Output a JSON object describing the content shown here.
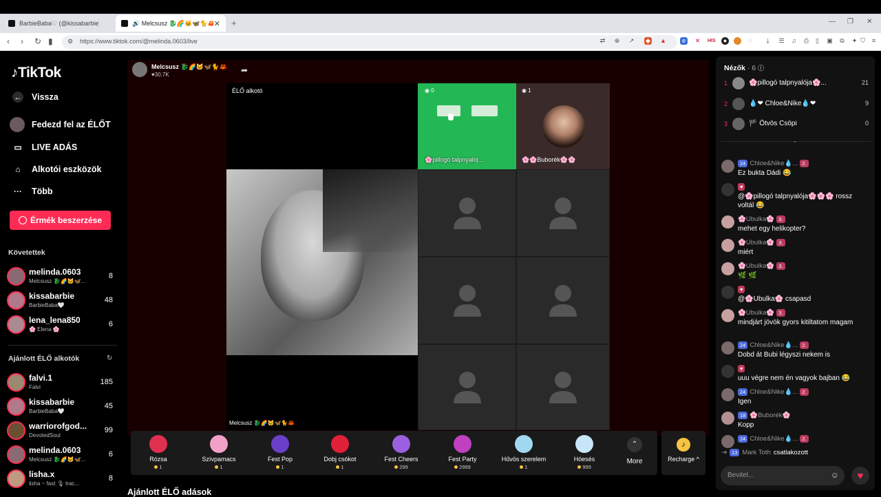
{
  "browser": {
    "tabs": [
      {
        "title": "BarbieBaba♡ (@kissabarbie) Élő",
        "active": false
      },
      {
        "title": "🔊 Melcsusz 🐉🌈🐱🦋🐈🦀 (@",
        "active": true
      }
    ],
    "url": "https://www.tiktok.com/@melinda.0603/live"
  },
  "sidebar": {
    "logo": "TikTok",
    "nav": [
      {
        "label": "Vissza",
        "icon": "arrow-left-icon"
      },
      {
        "label": "Fedezd fel az ÉLŐT",
        "icon": "avatar-icon"
      },
      {
        "label": "LIVE ADÁS",
        "icon": "video-camera-icon"
      },
      {
        "label": "Alkotói eszközök",
        "icon": "lightbulb-icon"
      },
      {
        "label": "Több",
        "icon": "more-dots-icon"
      }
    ],
    "coins_button": "Érmék beszerzése",
    "following_title": "Követettek",
    "following": [
      {
        "name": "melinda.0603",
        "sub": "Melcsusz 🐉🌈🐱🦋...",
        "count": "8"
      },
      {
        "name": "kissabarbie",
        "sub": "BarbieBaba🤍",
        "count": "48"
      },
      {
        "name": "lena_lena850",
        "sub": "🌸 Elena 🌸",
        "count": "6"
      }
    ],
    "recommended_title": "Ajánlott ÉLŐ alkotók",
    "recommended": [
      {
        "name": "falvi.1",
        "sub": "Falvi",
        "count": "185"
      },
      {
        "name": "kissabarbie",
        "sub": "BarbieBaba🤍",
        "count": "45"
      },
      {
        "name": "warriorofgod...",
        "sub": "DevotedSoul",
        "count": "99"
      },
      {
        "name": "melinda.0603",
        "sub": "Melcsusz 🐉🌈🐱🦋...",
        "count": "6"
      },
      {
        "name": "lisha.x",
        "sub": "lisha ~ fast 🎙 trac...",
        "count": "8"
      }
    ]
  },
  "live": {
    "host_name": "Melcsusz 🐉🌈🐱🦋🐈🦀",
    "host_likes": "♥30.7K",
    "host_label": "ÉLŐ alkotó",
    "guest1_count": "0",
    "guest1_name": "🌸pillogó talpnyalój...",
    "guest2_count": "1",
    "guest2_name": "🌸🌸Buborék🌸🌸",
    "bottom_host_label": "Melcsusz 🐉🌈🐱🦋🐈🦀"
  },
  "gifts": [
    {
      "name": "Rózsa",
      "price": "1",
      "color": "#e03050"
    },
    {
      "name": "Szívpamacs",
      "price": "1",
      "color": "#f2a0c8"
    },
    {
      "name": "Fest Pop",
      "price": "1",
      "color": "#6a40c8"
    },
    {
      "name": "Dobj csókot",
      "price": "1",
      "color": "#e0203a"
    },
    {
      "name": "Fest Cheers",
      "price": "299",
      "color": "#9a60e0"
    },
    {
      "name": "Fest Party",
      "price": "2999",
      "color": "#c040c0"
    },
    {
      "name": "Hűvös szerelem",
      "price": "1",
      "color": "#a0d8f0"
    },
    {
      "name": "Hóesés",
      "price": "999",
      "color": "#c8e4f8"
    }
  ],
  "more_label": "More",
  "recharge_label": "Recharge ^",
  "recommended_lives_title": "Ajánlott ÉLŐ adások",
  "chat": {
    "viewers_label": "Nézők",
    "viewers_count": "· 6",
    "top_viewers": [
      {
        "rank": "1",
        "name": "🌸pillogó talpnyalója🌸...",
        "score": "21"
      },
      {
        "rank": "2",
        "name": "💧❤ Chloe&Nike💧❤",
        "score": "9"
      },
      {
        "rank": "3",
        "name": "🏴 Ötvös Csöpi",
        "score": "0"
      }
    ],
    "messages": [
      {
        "badges": [
          "24",
          "2."
        ],
        "user": "Chloe&Nike💧...",
        "text": "Ez bukta Dádi 😂"
      },
      {
        "badges": [],
        "user": "",
        "text": "@🌸pillogó talpnyalója🌸🌸🌸 rossz voltál 😂"
      },
      {
        "badges": [
          "3."
        ],
        "user": "🌸Ubulka🌸",
        "text": "mehet egy helikopter?"
      },
      {
        "badges": [
          "3."
        ],
        "user": "🌸Ubulka🌸",
        "text": "miért"
      },
      {
        "badges": [
          "3."
        ],
        "user": "🌸Ubulka🌸",
        "text": "🌿 🌿"
      },
      {
        "badges": [],
        "user": "",
        "text": "@🌸Ubulka🌸 csapasd"
      },
      {
        "badges": [
          "3."
        ],
        "user": "🌸Ubulka🌸",
        "text": "mindjárt jövök gyors kitiltatom magam"
      },
      {
        "badges": [
          "24",
          "2."
        ],
        "user": "Chloe&Nike💧...",
        "text": "Dobd át Bubi légyszi nekem is"
      },
      {
        "badges": [],
        "user": "",
        "text": "uuu végre nem én vagyok bajban 😂"
      },
      {
        "badges": [
          "24",
          "2."
        ],
        "user": "Chloe&Nike💧...",
        "text": "Igen"
      },
      {
        "badges": [
          "18"
        ],
        "user": "🌸Buborék🌸",
        "text": "Kopp"
      },
      {
        "badges": [
          "24",
          "2."
        ],
        "user": "Chloe&Nike💧...",
        "text": ""
      }
    ],
    "join_badge": "13",
    "join_user": "Mark Toth",
    "join_text": "csatlakozott",
    "input_placeholder": "Bevitel..."
  }
}
